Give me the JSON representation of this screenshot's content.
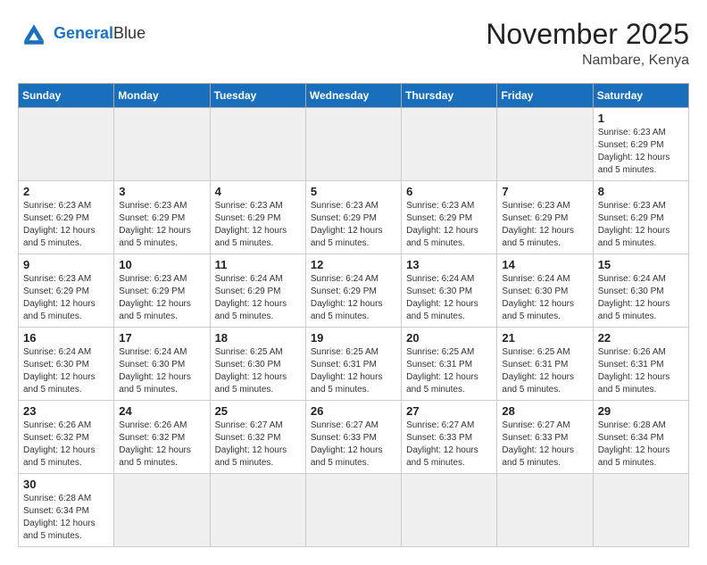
{
  "header": {
    "logo_general": "General",
    "logo_blue": "Blue",
    "title": "November 2025",
    "subtitle": "Nambare, Kenya"
  },
  "weekdays": [
    "Sunday",
    "Monday",
    "Tuesday",
    "Wednesday",
    "Thursday",
    "Friday",
    "Saturday"
  ],
  "weeks": [
    [
      {
        "day": "",
        "empty": true
      },
      {
        "day": "",
        "empty": true
      },
      {
        "day": "",
        "empty": true
      },
      {
        "day": "",
        "empty": true
      },
      {
        "day": "",
        "empty": true
      },
      {
        "day": "",
        "empty": true
      },
      {
        "day": "1",
        "sunrise": "6:23 AM",
        "sunset": "6:29 PM",
        "daylight": "12 hours and 5 minutes."
      }
    ],
    [
      {
        "day": "2",
        "sunrise": "6:23 AM",
        "sunset": "6:29 PM",
        "daylight": "12 hours and 5 minutes."
      },
      {
        "day": "3",
        "sunrise": "6:23 AM",
        "sunset": "6:29 PM",
        "daylight": "12 hours and 5 minutes."
      },
      {
        "day": "4",
        "sunrise": "6:23 AM",
        "sunset": "6:29 PM",
        "daylight": "12 hours and 5 minutes."
      },
      {
        "day": "5",
        "sunrise": "6:23 AM",
        "sunset": "6:29 PM",
        "daylight": "12 hours and 5 minutes."
      },
      {
        "day": "6",
        "sunrise": "6:23 AM",
        "sunset": "6:29 PM",
        "daylight": "12 hours and 5 minutes."
      },
      {
        "day": "7",
        "sunrise": "6:23 AM",
        "sunset": "6:29 PM",
        "daylight": "12 hours and 5 minutes."
      },
      {
        "day": "8",
        "sunrise": "6:23 AM",
        "sunset": "6:29 PM",
        "daylight": "12 hours and 5 minutes."
      }
    ],
    [
      {
        "day": "9",
        "sunrise": "6:23 AM",
        "sunset": "6:29 PM",
        "daylight": "12 hours and 5 minutes."
      },
      {
        "day": "10",
        "sunrise": "6:23 AM",
        "sunset": "6:29 PM",
        "daylight": "12 hours and 5 minutes."
      },
      {
        "day": "11",
        "sunrise": "6:24 AM",
        "sunset": "6:29 PM",
        "daylight": "12 hours and 5 minutes."
      },
      {
        "day": "12",
        "sunrise": "6:24 AM",
        "sunset": "6:29 PM",
        "daylight": "12 hours and 5 minutes."
      },
      {
        "day": "13",
        "sunrise": "6:24 AM",
        "sunset": "6:30 PM",
        "daylight": "12 hours and 5 minutes."
      },
      {
        "day": "14",
        "sunrise": "6:24 AM",
        "sunset": "6:30 PM",
        "daylight": "12 hours and 5 minutes."
      },
      {
        "day": "15",
        "sunrise": "6:24 AM",
        "sunset": "6:30 PM",
        "daylight": "12 hours and 5 minutes."
      }
    ],
    [
      {
        "day": "16",
        "sunrise": "6:24 AM",
        "sunset": "6:30 PM",
        "daylight": "12 hours and 5 minutes."
      },
      {
        "day": "17",
        "sunrise": "6:24 AM",
        "sunset": "6:30 PM",
        "daylight": "12 hours and 5 minutes."
      },
      {
        "day": "18",
        "sunrise": "6:25 AM",
        "sunset": "6:30 PM",
        "daylight": "12 hours and 5 minutes."
      },
      {
        "day": "19",
        "sunrise": "6:25 AM",
        "sunset": "6:31 PM",
        "daylight": "12 hours and 5 minutes."
      },
      {
        "day": "20",
        "sunrise": "6:25 AM",
        "sunset": "6:31 PM",
        "daylight": "12 hours and 5 minutes."
      },
      {
        "day": "21",
        "sunrise": "6:25 AM",
        "sunset": "6:31 PM",
        "daylight": "12 hours and 5 minutes."
      },
      {
        "day": "22",
        "sunrise": "6:26 AM",
        "sunset": "6:31 PM",
        "daylight": "12 hours and 5 minutes."
      }
    ],
    [
      {
        "day": "23",
        "sunrise": "6:26 AM",
        "sunset": "6:32 PM",
        "daylight": "12 hours and 5 minutes."
      },
      {
        "day": "24",
        "sunrise": "6:26 AM",
        "sunset": "6:32 PM",
        "daylight": "12 hours and 5 minutes."
      },
      {
        "day": "25",
        "sunrise": "6:27 AM",
        "sunset": "6:32 PM",
        "daylight": "12 hours and 5 minutes."
      },
      {
        "day": "26",
        "sunrise": "6:27 AM",
        "sunset": "6:33 PM",
        "daylight": "12 hours and 5 minutes."
      },
      {
        "day": "27",
        "sunrise": "6:27 AM",
        "sunset": "6:33 PM",
        "daylight": "12 hours and 5 minutes."
      },
      {
        "day": "28",
        "sunrise": "6:27 AM",
        "sunset": "6:33 PM",
        "daylight": "12 hours and 5 minutes."
      },
      {
        "day": "29",
        "sunrise": "6:28 AM",
        "sunset": "6:34 PM",
        "daylight": "12 hours and 5 minutes."
      }
    ],
    [
      {
        "day": "30",
        "sunrise": "6:28 AM",
        "sunset": "6:34 PM",
        "daylight": "12 hours and 5 minutes."
      },
      {
        "day": "",
        "empty": true
      },
      {
        "day": "",
        "empty": true
      },
      {
        "day": "",
        "empty": true
      },
      {
        "day": "",
        "empty": true
      },
      {
        "day": "",
        "empty": true
      },
      {
        "day": "",
        "empty": true
      }
    ]
  ]
}
